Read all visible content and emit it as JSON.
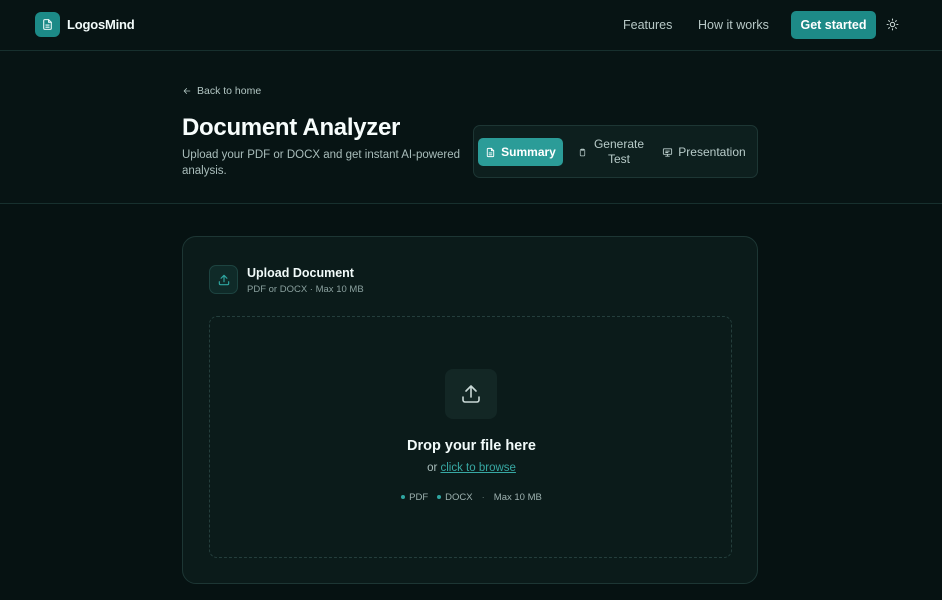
{
  "nav": {
    "brand": "LogosMind",
    "links": [
      "Features",
      "How it works"
    ],
    "cta": "Get started",
    "icons": {
      "logo": "document-icon",
      "theme": "sun-icon"
    }
  },
  "header": {
    "back": "Back to home",
    "title": "Document Analyzer",
    "subtitle": "Upload your PDF or DOCX and get instant AI-powered analysis.",
    "tabs": [
      {
        "label": "Summary",
        "icon": "document-icon",
        "active": true
      },
      {
        "label": "Generate Test",
        "icon": "clipboard-icon",
        "active": false
      },
      {
        "label": "Presentation",
        "icon": "presentation-icon",
        "active": false
      }
    ]
  },
  "upload": {
    "title": "Upload Document",
    "subtitle": "PDF or DOCX · Max 10 MB",
    "drop_title": "Drop your file here",
    "browse_prefix": "or",
    "browse_link": "click to browse",
    "formats": [
      "PDF",
      "DOCX"
    ],
    "separator": "·",
    "max_size": "Max 10 MB"
  },
  "colors": {
    "accent": "#1d8a87",
    "background": "#061212",
    "card": "#0b1b1a"
  }
}
